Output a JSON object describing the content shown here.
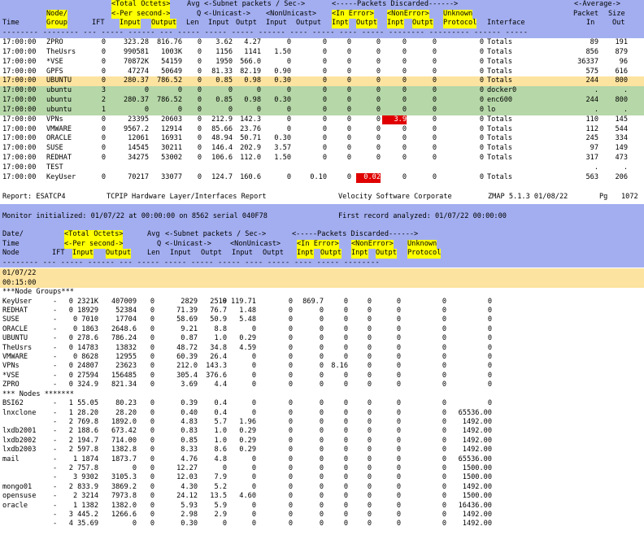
{
  "top": {
    "header": {
      "line1": {
        "total_octets": "<Total Octets>",
        "avg": "Avg",
        "subnet": "<-Subnet packets / Sec->",
        "discarded": "<-----Packets Discarded------>",
        "average": "<-Average->"
      },
      "line2": {
        "node": "Node/",
        "per_second": "<-Per second->",
        "q": "Q",
        "unicast": "<-Unicast->",
        "nonunicast": "<NonUnicast>",
        "in_error": "<In Error>",
        "nonerror": "<NonError>",
        "unknown": "Unknown",
        "packet": "Packet",
        "size": "Size"
      },
      "line3": {
        "time": "Time",
        "group": "Group",
        "ift": "IFT",
        "input": "Input",
        "output": "Output",
        "len": "Len",
        "input2": "Input",
        "outpt": "Outpt",
        "input3": "Input",
        "output3": "Output",
        "inpt": "Inpt",
        "outpt2": "Outpt",
        "inpt2": "Inpt",
        "outpt3": "Outpt",
        "protocol": "Protocol",
        "interface": "Interface",
        "in": "In",
        "out": "Out"
      },
      "dashes": "-------- -------- --- ----- ------ --- ----- ----- ----- ------ ---- ----- ---- ----- -------- --------- ------ -----"
    },
    "rows": [
      {
        "time": "17:00:00",
        "node": "ZPRO",
        "ift": "0",
        "input": "323.28",
        "output": "816.76",
        "len": "0",
        "uin": "3.62",
        "uout": "4.27",
        "nin": "0",
        "nout": "0",
        "ein": "0",
        "eout": "0",
        "nein": "0",
        "neout": "0",
        "unk": "0",
        "iface": "Totals",
        "pin": "89",
        "pout": "191",
        "style": ""
      },
      {
        "time": "17:00:00",
        "node": "TheUsrs",
        "ift": "0",
        "input": "990581",
        "output": "1003K",
        "len": "0",
        "uin": "1156",
        "uout": "1141",
        "nin": "1.50",
        "nout": "0",
        "ein": "0",
        "eout": "0",
        "nein": "0",
        "neout": "0",
        "unk": "0",
        "iface": "Totals",
        "pin": "856",
        "pout": "879",
        "style": ""
      },
      {
        "time": "17:00:00",
        "node": "*VSE",
        "ift": "0",
        "input": "70872K",
        "output": "54159",
        "len": "0",
        "uin": "1950",
        "uout": "566.0",
        "nin": "0",
        "nout": "0",
        "ein": "0",
        "eout": "0",
        "nein": "0",
        "neout": "0",
        "unk": "0",
        "iface": "Totals",
        "pin": "36337",
        "pout": "96",
        "style": ""
      },
      {
        "time": "17:00:00",
        "node": "GPFS",
        "ift": "0",
        "input": "47274",
        "output": "50649",
        "len": "0",
        "uin": "81.33",
        "uout": "82.19",
        "nin": "0.90",
        "nout": "0",
        "ein": "0",
        "eout": "0",
        "nein": "0",
        "neout": "0",
        "unk": "0",
        "iface": "Totals",
        "pin": "575",
        "pout": "616",
        "style": ""
      },
      {
        "time": "17:00:00",
        "node": "UBUNTU",
        "ift": "0",
        "input": "280.37",
        "output": "786.52",
        "len": "0",
        "uin": "0.85",
        "uout": "0.98",
        "nin": "0.30",
        "nout": "0",
        "ein": "0",
        "eout": "0",
        "nein": "0",
        "neout": "0",
        "unk": "0",
        "iface": "Totals",
        "pin": "244",
        "pout": "800",
        "style": "orange"
      },
      {
        "time": "17:00:00",
        "node": "ubuntu",
        "ift": "3",
        "input": "0",
        "output": "0",
        "len": "0",
        "uin": "0",
        "uout": "0",
        "nin": "0",
        "nout": "0",
        "ein": "0",
        "eout": "0",
        "nein": "0",
        "neout": "0",
        "unk": "0",
        "iface": "docker0",
        "pin": ".",
        "pout": ".",
        "style": "green"
      },
      {
        "time": "17:00:00",
        "node": "ubuntu",
        "ift": "2",
        "input": "280.37",
        "output": "786.52",
        "len": "0",
        "uin": "0.85",
        "uout": "0.98",
        "nin": "0.30",
        "nout": "0",
        "ein": "0",
        "eout": "0",
        "nein": "0",
        "neout": "0",
        "unk": "0",
        "iface": "enc600",
        "pin": "244",
        "pout": "800",
        "style": "green"
      },
      {
        "time": "17:00:00",
        "node": "ubuntu",
        "ift": "1",
        "input": "0",
        "output": "0",
        "len": "0",
        "uin": "0",
        "uout": "0",
        "nin": "0",
        "nout": "0",
        "ein": "0",
        "eout": "0",
        "nein": "0",
        "neout": "0",
        "unk": "0",
        "iface": "lo",
        "pin": ".",
        "pout": ".",
        "style": "green"
      },
      {
        "time": "17:00:00",
        "node": "VPNs",
        "ift": "0",
        "input": "23395",
        "output": "20603",
        "len": "0",
        "uin": "212.9",
        "uout": "142.3",
        "nin": "0",
        "nout": "0",
        "ein": "0",
        "eout": "0",
        "nein": "3.9",
        "neout": "0",
        "unk": "0",
        "iface": "Totals",
        "pin": "110",
        "pout": "145",
        "style": "",
        "red": "nein"
      },
      {
        "time": "17:00:00",
        "node": "VMWARE",
        "ift": "0",
        "input": "9567.2",
        "output": "12914",
        "len": "0",
        "uin": "85.66",
        "uout": "23.76",
        "nin": "0",
        "nout": "0",
        "ein": "0",
        "eout": "0",
        "nein": "0",
        "neout": "0",
        "unk": "0",
        "iface": "Totals",
        "pin": "112",
        "pout": "544",
        "style": ""
      },
      {
        "time": "17:00:00",
        "node": "ORACLE",
        "ift": "0",
        "input": "12061",
        "output": "16931",
        "len": "0",
        "uin": "48.94",
        "uout": "50.71",
        "nin": "0.30",
        "nout": "0",
        "ein": "0",
        "eout": "0",
        "nein": "0",
        "neout": "0",
        "unk": "0",
        "iface": "Totals",
        "pin": "245",
        "pout": "334",
        "style": ""
      },
      {
        "time": "17:00:00",
        "node": "SUSE",
        "ift": "0",
        "input": "14545",
        "output": "30211",
        "len": "0",
        "uin": "146.4",
        "uout": "202.9",
        "nin": "3.57",
        "nout": "0",
        "ein": "0",
        "eout": "0",
        "nein": "0",
        "neout": "0",
        "unk": "0",
        "iface": "Totals",
        "pin": "97",
        "pout": "149",
        "style": ""
      },
      {
        "time": "17:00:00",
        "node": "REDHAT",
        "ift": "0",
        "input": "34275",
        "output": "53002",
        "len": "0",
        "uin": "106.6",
        "uout": "112.0",
        "nin": "1.50",
        "nout": "0",
        "ein": "0",
        "eout": "0",
        "nein": "0",
        "neout": "0",
        "unk": "0",
        "iface": "Totals",
        "pin": "317",
        "pout": "473",
        "style": ""
      },
      {
        "time": "17:00:00",
        "node": "TEST",
        "ift": "",
        "input": "",
        "output": "",
        "len": "",
        "uin": "",
        "uout": "",
        "nin": "",
        "nout": "",
        "ein": "",
        "eout": "",
        "nein": "",
        "neout": "",
        "unk": "",
        "iface": "",
        "pin": ".",
        "pout": ".",
        "style": ""
      },
      {
        "time": "17:00:00",
        "node": "KeyUser",
        "ift": "0",
        "input": "70217",
        "output": "33077",
        "len": "0",
        "uin": "124.7",
        "uout": "160.6",
        "nin": "0",
        "nout": "0.10",
        "ein": "0",
        "eout": "0.02",
        "nein": "0",
        "neout": "0",
        "unk": "0",
        "iface": "Totals",
        "pin": "563",
        "pout": "206",
        "style": "",
        "red": "eout"
      }
    ]
  },
  "report": {
    "label": "Report: ESATCP4",
    "title": "TCPIP Hardware Layer/Interfaces Report",
    "vendor": "Velocity Software Corporate",
    "version": "ZMAP 5.1.3 01/08/22",
    "pg_label": "Pg",
    "pg": "1072"
  },
  "monitor": {
    "text": "Monitor initialized: 01/07/22 at 00:00:00 on 8562 serial 040F78",
    "first": "First record analyzed: 01/07/22 00:00:00"
  },
  "bottom": {
    "header": {
      "line1": {
        "date": "Date/",
        "total_octets": "<Total Octets>",
        "avg": "Avg",
        "subnet": "<-Subnet packets / Sec->",
        "discarded": "<-----Packets Discarded------>"
      },
      "line2": {
        "time": "Time",
        "per_second": "<-Per second->",
        "q": "Q",
        "unicast": "<-Unicast->",
        "nonunicast": "<NonUnicast>",
        "in_error": "<In Error>",
        "nonerror": "<NonError>",
        "unknown": "Unknown"
      },
      "line3": {
        "node": "Node",
        "ift": "IFT",
        "input": "Input",
        "output": "Output",
        "len": "Len",
        "input2": "Input",
        "outpt": "Outpt",
        "input3": "Input",
        "outpt3": "Outpt",
        "inpt": "Inpt",
        "outpt2": "Outpt",
        "inpt2": "Inpt",
        "outpt4": "Outpt",
        "protocol": "Protocol"
      },
      "dashes": "-------- --- ----- ------ --- ----- ----- ----- ----- ---- ----- ---- ----- --------"
    },
    "date": "01/07/22",
    "time": "00:15:00",
    "groups_label": "***Node Groups***",
    "nodes_label": "*** Nodes *******",
    "groups": [
      {
        "node": "KeyUser",
        "ift": "-",
        "input": "0 2321K",
        "output": "407009",
        "len": "0",
        "uin": "2829",
        "uout": "2519",
        "nin": "0 119.71",
        "nout": "0",
        "ein": "869.7",
        "eout": "0",
        "nein": "0",
        "neout": "0",
        "p1": "0",
        "p2": "0"
      },
      {
        "node": "REDHAT",
        "ift": "-",
        "input": "0 18929",
        "output": "52384",
        "len": "0",
        "uin": "71.39",
        "uout": "76.7",
        "nin": "1.48",
        "nout": "0",
        "ein": "0",
        "eout": "0",
        "nein": "0",
        "neout": "0",
        "p1": "0",
        "p2": "0"
      },
      {
        "node": "SUSE",
        "ift": "-",
        "input": "0 7010",
        "output": "17704",
        "len": "0",
        "uin": "58.69",
        "uout": "50.9",
        "nin": "5.48",
        "nout": "0",
        "ein": "0",
        "eout": "0",
        "nein": "0",
        "neout": "0",
        "p1": "0",
        "p2": "0"
      },
      {
        "node": "ORACLE",
        "ift": "-",
        "input": "0 1863",
        "output": "2648.6",
        "len": "0",
        "uin": "9.21",
        "uout": "8.8",
        "nin": "0",
        "nout": "0",
        "ein": "0",
        "eout": "0",
        "nein": "0",
        "neout": "0",
        "p1": "0",
        "p2": "0"
      },
      {
        "node": "UBUNTU",
        "ift": "-",
        "input": "0 278.6",
        "output": "786.24",
        "len": "0",
        "uin": "0.87",
        "uout": "1.0",
        "nin": "0.29",
        "nout": "0",
        "ein": "0",
        "eout": "0",
        "nein": "0",
        "neout": "0",
        "p1": "0",
        "p2": "0"
      },
      {
        "node": "TheUsrs",
        "ift": "-",
        "input": "0 14783",
        "output": "13832",
        "len": "0",
        "uin": "48.72",
        "uout": "34.8",
        "nin": "4.59",
        "nout": "0",
        "ein": "0",
        "eout": "0",
        "nein": "0",
        "neout": "0",
        "p1": "0",
        "p2": "0"
      },
      {
        "node": "VMWARE",
        "ift": "-",
        "input": "0 8628",
        "output": "12955",
        "len": "0",
        "uin": "60.39",
        "uout": "26.4",
        "nin": "0",
        "nout": "0",
        "ein": "0",
        "eout": "0",
        "nein": "0",
        "neout": "0",
        "p1": "0",
        "p2": "0"
      },
      {
        "node": "VPNs",
        "ift": "-",
        "input": "0 24807",
        "output": "23623",
        "len": "0",
        "uin": "212.0",
        "uout": "143.3",
        "nin": "0",
        "nout": "0",
        "ein": "0",
        "eout": "8.16",
        "nein": "0",
        "neout": "0",
        "p1": "0",
        "p2": "0"
      },
      {
        "node": "*VSE",
        "ift": "-",
        "input": "0 27594",
        "output": "156485",
        "len": "0",
        "uin": "305.4",
        "uout": "376.6",
        "nin": "0",
        "nout": "0",
        "ein": "0",
        "eout": "0",
        "nein": "0",
        "neout": "0",
        "p1": "0",
        "p2": "0"
      },
      {
        "node": "ZPRO",
        "ift": "-",
        "input": "0 324.9",
        "output": "821.34",
        "len": "0",
        "uin": "3.69",
        "uout": "4.4",
        "nin": "0",
        "nout": "0",
        "ein": "0",
        "eout": "0",
        "nein": "0",
        "neout": "0",
        "p1": "0",
        "p2": "0"
      }
    ],
    "nodes": [
      {
        "node": "BSI62",
        "ift": "-",
        "input": "1 55.05",
        "output": "80.23",
        "len": "0",
        "uin": "0.39",
        "uout": "0.4",
        "nin": "0",
        "nout": "0",
        "ein": "0",
        "eout": "0",
        "nein": "0",
        "neout": "0",
        "p1": "0",
        "p2": "0"
      },
      {
        "node": "lnxclone",
        "ift": "-",
        "input": "1 28.20",
        "output": "28.20",
        "len": "0",
        "uin": "0.40",
        "uout": "0.4",
        "nin": "0",
        "nout": "0",
        "ein": "0",
        "eout": "0",
        "nein": "0",
        "neout": "0",
        "p1": "0",
        "p2": "65536.00"
      },
      {
        "node": "",
        "ift": "-",
        "input": "2 769.8",
        "output": "1892.0",
        "len": "0",
        "uin": "4.83",
        "uout": "5.7",
        "nin": "1.96",
        "nout": "0",
        "ein": "0",
        "eout": "0",
        "nein": "0",
        "neout": "0",
        "p1": "0",
        "p2": "1492.00"
      },
      {
        "node": "lxdb2001",
        "ift": "-",
        "input": "2 188.6",
        "output": "673.42",
        "len": "0",
        "uin": "0.83",
        "uout": "1.0",
        "nin": "0.29",
        "nout": "0",
        "ein": "0",
        "eout": "0",
        "nein": "0",
        "neout": "0",
        "p1": "0",
        "p2": "1492.00"
      },
      {
        "node": "lxdb2002",
        "ift": "-",
        "input": "2 194.7",
        "output": "714.00",
        "len": "0",
        "uin": "0.85",
        "uout": "1.0",
        "nin": "0.29",
        "nout": "0",
        "ein": "0",
        "eout": "0",
        "nein": "0",
        "neout": "0",
        "p1": "0",
        "p2": "1492.00"
      },
      {
        "node": "lxdb2003",
        "ift": "-",
        "input": "2 597.8",
        "output": "1382.8",
        "len": "0",
        "uin": "8.33",
        "uout": "8.6",
        "nin": "0.29",
        "nout": "0",
        "ein": "0",
        "eout": "0",
        "nein": "0",
        "neout": "0",
        "p1": "0",
        "p2": "1492.00"
      },
      {
        "node": "mail",
        "ift": "-",
        "input": "1 1874",
        "output": "1873.7",
        "len": "0",
        "uin": "4.76",
        "uout": "4.8",
        "nin": "0",
        "nout": "0",
        "ein": "0",
        "eout": "0",
        "nein": "0",
        "neout": "0",
        "p1": "0",
        "p2": "65536.00"
      },
      {
        "node": "",
        "ift": "-",
        "input": "2 757.8",
        "output": "0",
        "len": "0",
        "uin": "12.27",
        "uout": "0",
        "nin": "0",
        "nout": "0",
        "ein": "0",
        "eout": "0",
        "nein": "0",
        "neout": "0",
        "p1": "0",
        "p2": "1500.00"
      },
      {
        "node": "",
        "ift": "-",
        "input": "3 9302",
        "output": "3105.3",
        "len": "0",
        "uin": "12.03",
        "uout": "7.9",
        "nin": "0",
        "nout": "0",
        "ein": "0",
        "eout": "0",
        "nein": "0",
        "neout": "0",
        "p1": "0",
        "p2": "1500.00"
      },
      {
        "node": "mongo01",
        "ift": "-",
        "input": "2 833.9",
        "output": "3869.2",
        "len": "0",
        "uin": "4.30",
        "uout": "5.2",
        "nin": "0",
        "nout": "0",
        "ein": "0",
        "eout": "0",
        "nein": "0",
        "neout": "0",
        "p1": "0",
        "p2": "1492.00"
      },
      {
        "node": "opensuse",
        "ift": "-",
        "input": "2 3214",
        "output": "7973.8",
        "len": "0",
        "uin": "24.12",
        "uout": "13.5",
        "nin": "4.60",
        "nout": "0",
        "ein": "0",
        "eout": "0",
        "nein": "0",
        "neout": "0",
        "p1": "0",
        "p2": "1500.00"
      },
      {
        "node": "oracle",
        "ift": "-",
        "input": "1 1382",
        "output": "1382.0",
        "len": "0",
        "uin": "5.93",
        "uout": "5.9",
        "nin": "0",
        "nout": "0",
        "ein": "0",
        "eout": "0",
        "nein": "0",
        "neout": "0",
        "p1": "0",
        "p2": "16436.00"
      },
      {
        "node": "",
        "ift": "-",
        "input": "3 445.2",
        "output": "1266.6",
        "len": "0",
        "uin": "2.98",
        "uout": "2.9",
        "nin": "0",
        "nout": "0",
        "ein": "0",
        "eout": "0",
        "nein": "0",
        "neout": "0",
        "p1": "0",
        "p2": "1492.00"
      },
      {
        "node": "",
        "ift": "-",
        "input": "4 35.69",
        "output": "0",
        "len": "0",
        "uin": "0.30",
        "uout": "0",
        "nin": "0",
        "nout": "0",
        "ein": "0",
        "eout": "0",
        "nein": "0",
        "neout": "0",
        "p1": "0",
        "p2": "1492.00"
      }
    ]
  }
}
